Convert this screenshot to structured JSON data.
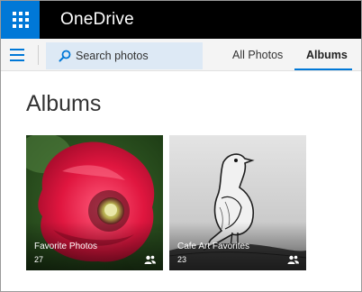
{
  "app": {
    "title": "OneDrive"
  },
  "toolbar": {
    "search_label": "Search photos",
    "tabs": [
      {
        "label": "All Photos",
        "selected": false
      },
      {
        "label": "Albums",
        "selected": true
      }
    ]
  },
  "page": {
    "title": "Albums"
  },
  "albums": [
    {
      "name": "Favorite Photos",
      "count": "27",
      "shared_icon": "people-icon"
    },
    {
      "name": "Cafe Art Favorites",
      "count": "23",
      "shared_icon": "people-icon"
    }
  ],
  "colors": {
    "accent": "#0078d7",
    "topbar": "#000000",
    "search_bg": "#dde9f5"
  }
}
